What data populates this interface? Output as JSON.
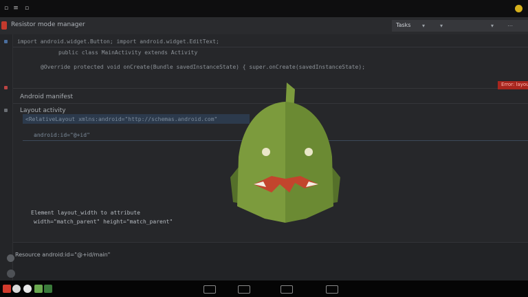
{
  "header": {
    "title": "Resistor mode manager",
    "tab_label": "Tasks"
  },
  "editor": {
    "lines": [
      "import android.widget.Button;  import android.widget.EditText;",
      "public class MainActivity extends Activity",
      "@Override protected void onCreate(Bundle savedInstanceState) {  super.onCreate(savedInstanceState);"
    ],
    "error_text": "Error: layout",
    "section_1": "Android manifest",
    "section_2": "Layout activity",
    "selected_line": "<RelativeLayout xmlns:android=\"http://schemas.android.com\"",
    "selected_sub": "android:id=\"@+id\"",
    "block_line_1": "Element layout_width to attribute",
    "block_line_2": "width=\"match_parent\"  height=\"match_parent\"",
    "notice": "Resource android:id=\"@+id/main\""
  },
  "colors": {
    "mascot_green": "#7c9b3d",
    "mascot_dark": "#5f7d2c",
    "mouth_red": "#c2452d",
    "error_red": "#a8261e"
  }
}
